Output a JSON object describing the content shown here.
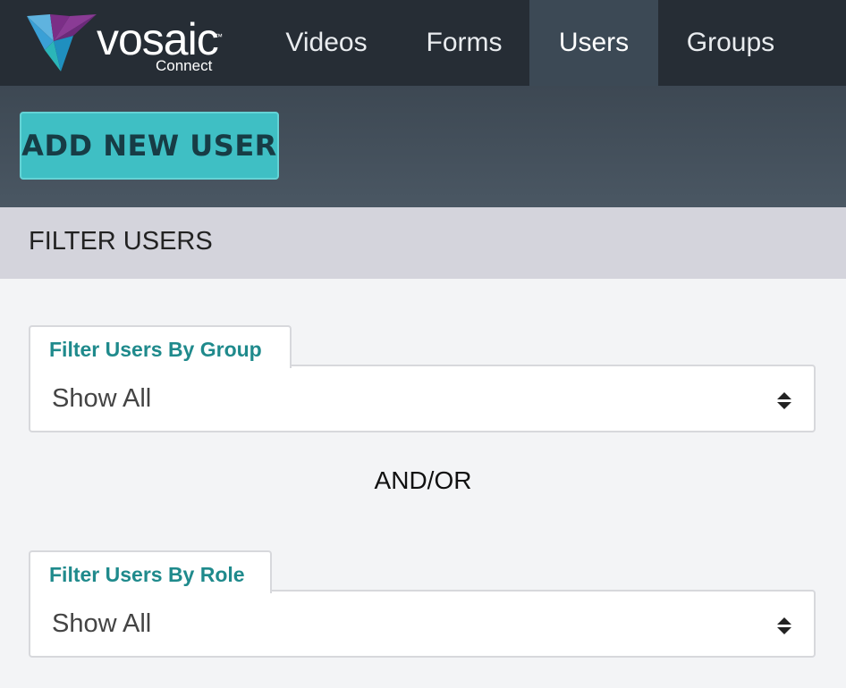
{
  "brand": {
    "name": "vosaic",
    "trademark": "™",
    "subtitle": "Connect",
    "colors": {
      "purple": "#7b2e87",
      "teal": "#2bb5b8",
      "light_blue": "#5fb3df",
      "blue": "#1f8fbf"
    }
  },
  "nav": {
    "items": [
      {
        "label": "Videos",
        "active": false
      },
      {
        "label": "Forms",
        "active": false
      },
      {
        "label": "Users",
        "active": true
      },
      {
        "label": "Groups",
        "active": false
      }
    ]
  },
  "actions": {
    "add_user_label": "ADD NEW USER"
  },
  "filter": {
    "title": "FILTER USERS",
    "group": {
      "label": "Filter Users By Group",
      "value": "Show All",
      "icon": "sort-arrows-icon"
    },
    "separator": "AND/OR",
    "role": {
      "label": "Filter Users By Role",
      "value": "Show All",
      "icon": "sort-arrows-icon"
    }
  },
  "colors": {
    "nav_bg": "#262d35",
    "nav_active_bg": "#3c4955",
    "button_bg": "#3fbfc4",
    "label_teal": "#1f8a8c",
    "filter_header_bg": "#d4d4dc"
  }
}
